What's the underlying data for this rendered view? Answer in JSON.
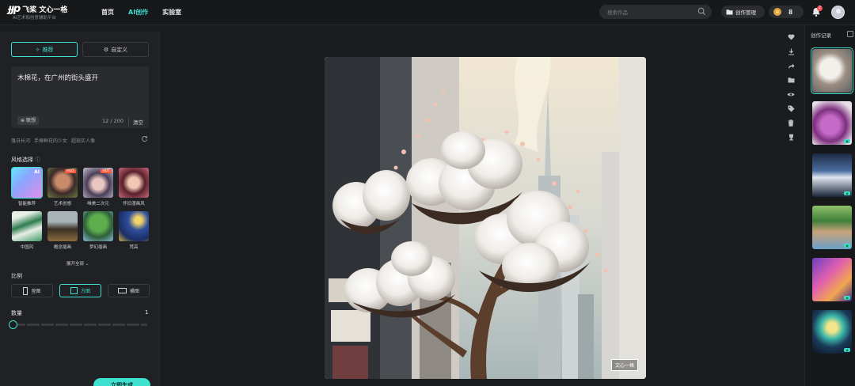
{
  "header": {
    "logo_mark": "ɟɟp",
    "logo_text": "飞桨 文心一格",
    "logo_sub": "AI艺术和创意辅助平台",
    "nav": [
      "首页",
      "AI创作",
      "实验室"
    ],
    "search_placeholder": "搜索作品",
    "manage_label": "创作管理",
    "coin_count": "8",
    "bell_count": "2",
    "accent": "#3ee0d0"
  },
  "left": {
    "tabs": [
      "推荐",
      "自定义"
    ],
    "prompt": "木棉花，在广州的街头盛开",
    "assoc_label": "联想",
    "counter": "12 / 200",
    "clear_label": "清空",
    "suggestions": [
      "落日长河",
      "手捧鲜花的少女",
      "超现实人像"
    ],
    "style_title": "风格选择",
    "styles": [
      {
        "label": "智能推荐",
        "hot": ""
      },
      {
        "label": "艺术创想",
        "hot": "HOT"
      },
      {
        "label": "唯美二次元",
        "hot": "HOT"
      },
      {
        "label": "怀旧漫画风",
        "hot": ""
      },
      {
        "label": "中国风",
        "hot": ""
      },
      {
        "label": "概念插画",
        "hot": ""
      },
      {
        "label": "梦幻插画",
        "hot": ""
      },
      {
        "label": "梵高",
        "hot": ""
      }
    ],
    "expand_label": "展开全部",
    "ratio_title": "比例",
    "ratios": [
      "竖图",
      "方图",
      "横图"
    ],
    "count_title": "数量",
    "count_value": "1",
    "generate_label": "立即生成"
  },
  "center": {
    "watermark": "文心一格"
  },
  "right": {
    "history_title": "创作记录"
  }
}
